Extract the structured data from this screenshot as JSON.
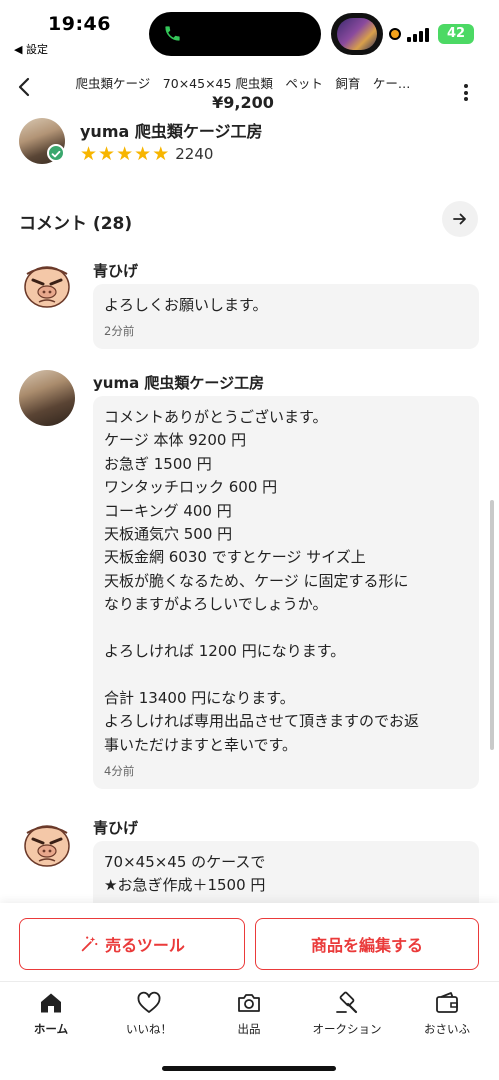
{
  "status_bar": {
    "time": "19:46",
    "back_app": "◀ 設定",
    "battery": "42",
    "accent_green": "#4cd964"
  },
  "header": {
    "title": "爬虫類ケージ　70×45×45 爬虫類　ペット　飼育　ケー…",
    "price": "¥9,200",
    "icons": [
      "back-chevron-icon",
      "more-vertical-icon"
    ]
  },
  "seller": {
    "name": "yuma 爬虫類ケージ工房",
    "rating_stars": 5,
    "rating_count": "2240"
  },
  "comments_section": {
    "title": "コメント (28)"
  },
  "comments": [
    {
      "name": "青ひげ",
      "avatar": "cartoon-face",
      "text": "よろしくお願いします。",
      "time": "2分前"
    },
    {
      "name": "yuma 爬虫類ケージ工房",
      "avatar": "photo",
      "text": "コメントありがとうございます。\nケージ 本体 9200 円\nお急ぎ 1500 円\nワンタッチロック 600 円\nコーキング 400 円\n天板通気穴 500 円\n天板金網 6030 ですとケージ サイズ上\n天板が脆くなるため、ケージ に固定する形に\nなりますがよろしいでしょうか。\n\nよろしければ 1200 円になります。\n\n合計 13400 円になります。\nよろしければ専用出品させて頂きますのでお返\n事いただけますと幸いです。",
      "time": "4分前"
    },
    {
      "name": "青ひげ",
      "avatar": "cartoon-face",
      "text": "70×45×45 のケースで\n★お急ぎ作成＋1500 円",
      "time": ""
    }
  ],
  "actions": {
    "sell_tool": "売るツール",
    "edit_item": "商品を編集する",
    "accent": "#ea3a3a"
  },
  "tabs": [
    {
      "label": "ホーム",
      "icon": "home-icon",
      "active": true
    },
    {
      "label": "いいね！",
      "icon": "heart-icon",
      "active": false
    },
    {
      "label": "出品",
      "icon": "camera-icon",
      "active": false
    },
    {
      "label": "オークション",
      "icon": "gavel-icon",
      "active": false
    },
    {
      "label": "おさいふ",
      "icon": "wallet-icon",
      "active": false
    }
  ]
}
